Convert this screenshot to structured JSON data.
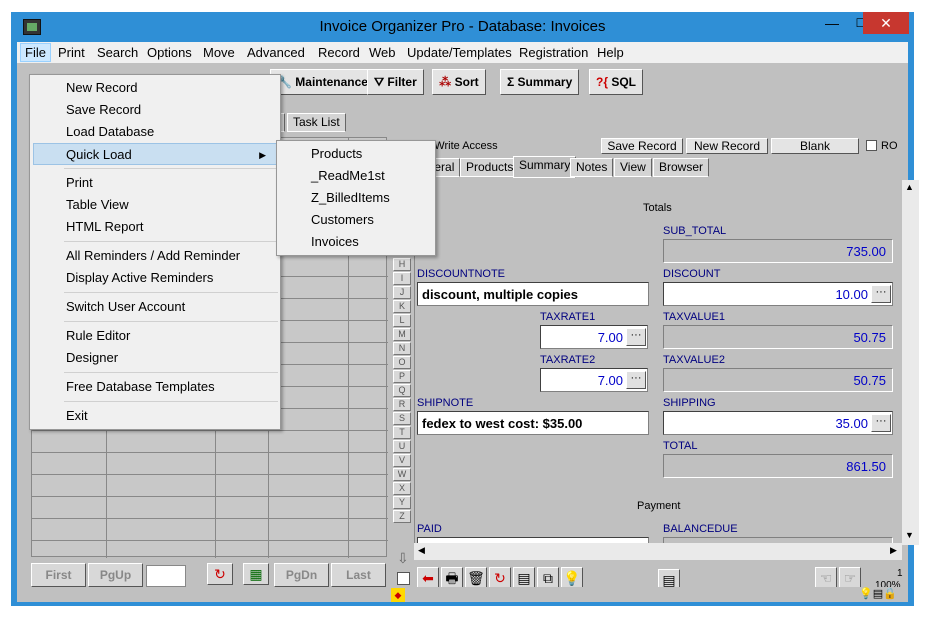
{
  "window": {
    "title": "Invoice Organizer Pro - Database: Invoices",
    "min": "—",
    "max": "☐",
    "close": "✕"
  },
  "menu": [
    "File",
    "Print",
    "Search",
    "Options",
    "Move",
    "Advanced",
    "Record",
    "Web",
    "Update/Templates",
    "Registration",
    "Help"
  ],
  "toolbar": {
    "maintenance": "Maintenance",
    "filter": "Filter",
    "sort": "Sort",
    "summary": "Summary",
    "sql": "SQL"
  },
  "file_menu": {
    "items": [
      "New Record",
      "Save Record",
      "Load Database",
      "Quick Load",
      "Print",
      "Table View",
      "HTML Report",
      "All Reminders / Add Reminder",
      "Display Active Reminders",
      "Switch User Account",
      "Rule Editor",
      "Designer",
      "Free Database Templates",
      "Exit"
    ]
  },
  "quick_load": [
    "Products",
    "_ReadMe1st",
    "Z_BilledItems",
    "Customers",
    "Invoices"
  ],
  "left_tabs": {
    "partial": "s",
    "task_list": "Task List"
  },
  "alphabet": [
    "H",
    "I",
    "J",
    "K",
    "L",
    "M",
    "N",
    "O",
    "P",
    "Q",
    "R",
    "S",
    "T",
    "U",
    "V",
    "W",
    "X",
    "Y",
    "Z"
  ],
  "record_bar": {
    "access": "ad/Write Access",
    "save": "Save Record",
    "new": "New Record",
    "blank": "Blank",
    "ro": "RO"
  },
  "tabs": [
    "eneral",
    "Products",
    "Summary",
    "Notes",
    "View",
    "Browser"
  ],
  "form": {
    "totals_header": "Totals",
    "payment_header": "Payment",
    "sub_total_label": "SUB_TOTAL",
    "sub_total": "735.00",
    "discountnote_label": "DISCOUNTNOTE",
    "discountnote": "discount, multiple copies",
    "discount_label": "DISCOUNT",
    "discount": "10.00",
    "taxrate1_label": "TAXRATE1",
    "taxrate1": "7.00",
    "taxvalue1_label": "TAXVALUE1",
    "taxvalue1": "50.75",
    "taxrate2_label": "TAXRATE2",
    "taxrate2": "7.00",
    "taxvalue2_label": "TAXVALUE2",
    "taxvalue2": "50.75",
    "shipnote_label": "SHIPNOTE",
    "shipnote": "fedex to west cost: $35.00",
    "shipping_label": "SHIPPING",
    "shipping": "35.00",
    "total_label": "TOTAL",
    "total": "861.50",
    "paid_label": "PAID",
    "balancedue_label": "BALANCEDUE",
    "dots": "···"
  },
  "nav": {
    "first": "First",
    "pgup": "PgUp",
    "pgdn": "PgDn",
    "last": "Last"
  },
  "status": {
    "page": "1",
    "zoom": "100%"
  }
}
